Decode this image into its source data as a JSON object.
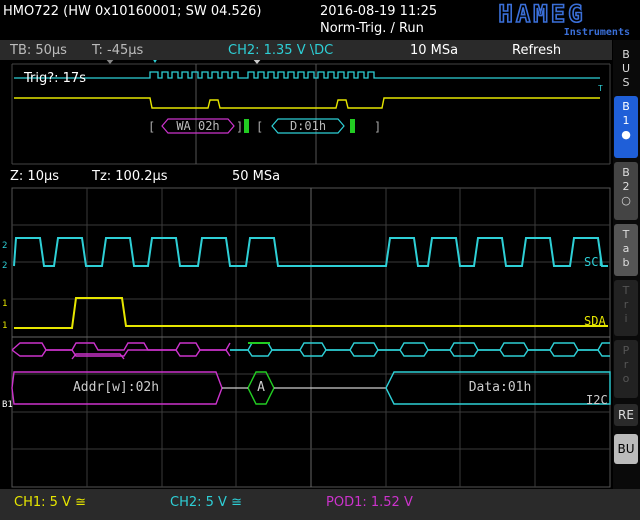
{
  "header": {
    "title": "HMO722 (HW 0x10160001; SW 04.526)",
    "datetime": "2016-08-19 11:25",
    "trigger_mode": "Norm-Trig. / Run",
    "logo_text": "HAMEG",
    "logo_sub": "Instruments"
  },
  "infobar": {
    "timebase": "TB: 50µs",
    "trigger_time": "T: -45µs",
    "trigger_source": "CH2: 1.35 V \\DC",
    "sample_rate": "10 MSa",
    "refresh": "Refresh"
  },
  "overview": {
    "trig_label": "Trig?: 17s",
    "bus_frames": [
      "WA 02h",
      "D:01h"
    ]
  },
  "zoombar": {
    "zoom": "Z: 10µs",
    "tz": "Tz: 100.2µs",
    "sample_rate": "50 MSa"
  },
  "zoom": {
    "scl_label": "SCL",
    "sda_label": "SDA",
    "i2c_label": "I2C",
    "b1_label": "B1",
    "addr_text": "Addr[w]:02h",
    "ack_text": "A",
    "data_text": "Data:01h"
  },
  "bottombar": {
    "ch1": "CH1: 5 V ≅",
    "ch2": "CH2: 5 V ≅",
    "pod1": "POD1: 1.52 V"
  },
  "menu": {
    "bus": [
      "B",
      "U",
      "S"
    ],
    "b1": [
      "B",
      "1"
    ],
    "b2": [
      "B",
      "2"
    ],
    "tab": [
      "T",
      "a",
      "b"
    ],
    "faded1": [
      "T",
      "r",
      "i"
    ],
    "faded2": [
      "P",
      "r",
      "o"
    ],
    "re": "RE",
    "bu": "BU"
  },
  "colors": {
    "ch1": "#e6e600",
    "ch2": "#2ecfd6",
    "pod": "#cc33cc",
    "bus_green": "#22cc22",
    "accent": "#3a6fd8"
  }
}
